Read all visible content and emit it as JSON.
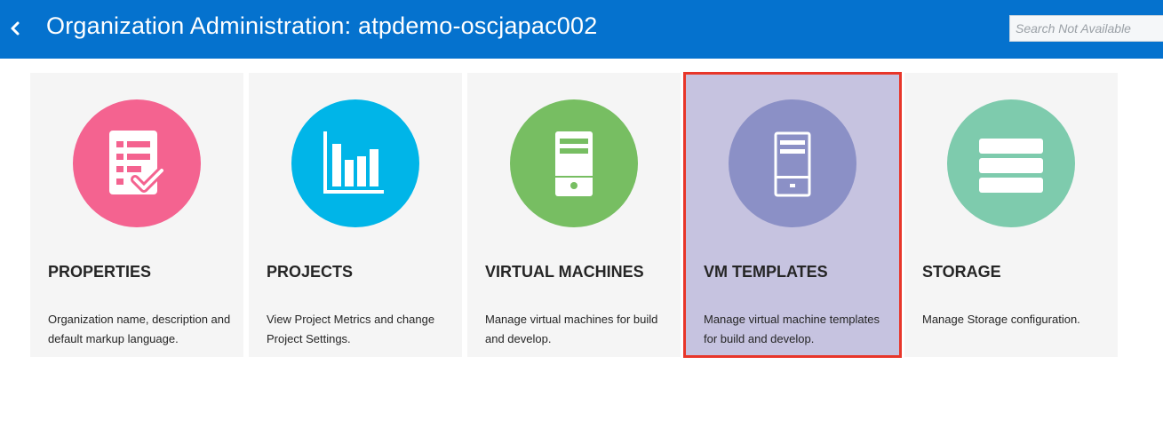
{
  "header": {
    "title": "Organization Administration: atpdemo-oscjapac002",
    "back_icon": "chevron-left-icon",
    "search_placeholder": "Search Not Available",
    "background_color": "#0572ce"
  },
  "cards": [
    {
      "title": "PROPERTIES",
      "description": "Organization name, description and default markup language.",
      "icon": "checklist-icon",
      "color": "#f46390",
      "selected": false
    },
    {
      "title": "PROJECTS",
      "description": "View Project Metrics and change Project Settings.",
      "icon": "bar-chart-icon",
      "color": "#00b5e8",
      "selected": false
    },
    {
      "title": "VIRTUAL MACHINES",
      "description": "Manage virtual machines for build and develop.",
      "icon": "server-icon",
      "color": "#77be62",
      "selected": false
    },
    {
      "title": "VM TEMPLATES",
      "description": "Manage virtual machine templates for build and develop.",
      "icon": "server-outline-icon",
      "color": "#8b90c6",
      "selected": true
    },
    {
      "title": "STORAGE",
      "description": "Manage Storage configuration.",
      "icon": "storage-stack-icon",
      "color": "#7ecbad",
      "selected": false
    }
  ],
  "selection_border_color": "#e8362a"
}
